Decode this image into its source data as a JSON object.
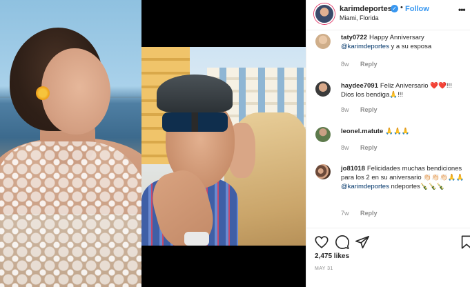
{
  "post": {
    "username": "karimdeportes",
    "location": "Miami, Florida",
    "follow_label": "Follow",
    "separator": "•",
    "more_glyph": "•••",
    "verified_glyph": "✓"
  },
  "comments": [
    {
      "username": "taty0722",
      "text": "Happy Anniversary",
      "mention": "@karimdeportes",
      "after_mention": " y a su esposa",
      "time": "8w",
      "reply_label": "Reply"
    },
    {
      "username": "haydee7091",
      "text": "Feliz Aniversario ❤️❤️!!! Dios los bendiga🙏!!!",
      "time": "8w",
      "reply_label": "Reply"
    },
    {
      "username": "leonel.matute",
      "text": "🙏🙏🙏",
      "time": "8w",
      "reply_label": "Reply"
    },
    {
      "username": "jo81018",
      "text": "Felicidades muchas bendiciones para los 2 en su aniversario 👏🏻👏🏻👏🏻🙏🙏",
      "mention": "@karimdeportes",
      "after_mention": " ndeportes🍾🍾🍾",
      "time": "7w",
      "reply_label": "Reply"
    }
  ],
  "stats": {
    "likes": "2,475 likes",
    "date": "MAY 31"
  },
  "icons": {
    "like": "heart-icon",
    "comment": "comment-icon",
    "share": "share-icon",
    "save": "bookmark-icon"
  },
  "colors": {
    "accent": "#3897f0",
    "mention": "#003569",
    "muted": "#8e8e8e"
  }
}
